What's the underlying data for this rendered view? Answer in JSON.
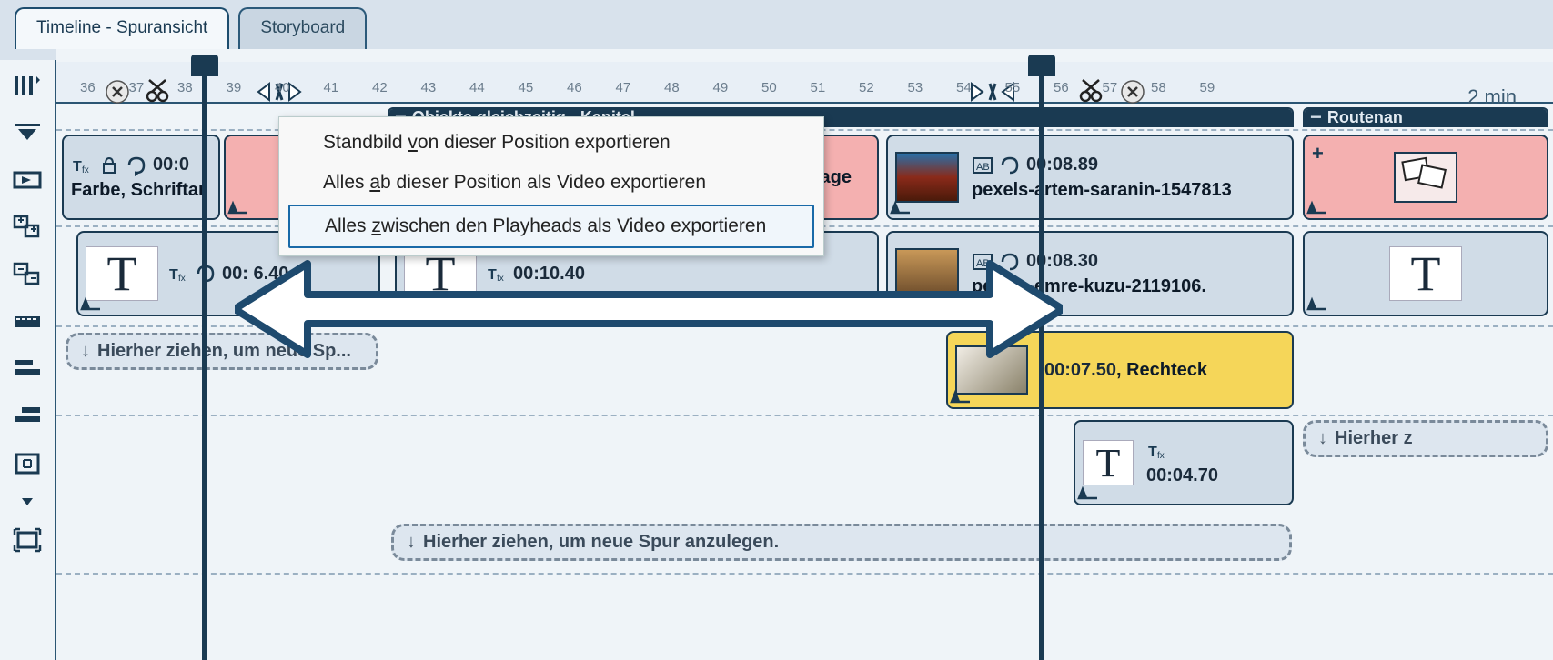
{
  "tabs": {
    "timeline": "Timeline - Spuransicht",
    "storyboard": "Storyboard"
  },
  "ruler": {
    "ticks": [
      "36",
      "37",
      "38",
      "39",
      "40",
      "41",
      "42",
      "43",
      "44",
      "45",
      "46",
      "47",
      "48",
      "49",
      "50",
      "51",
      "52",
      "53",
      "54",
      "55",
      "56",
      "57",
      "58",
      "59"
    ],
    "label": "2 min"
  },
  "chapters": {
    "objekte": "Objekte gleichzeitig - Kapitel",
    "routen": "Routenan"
  },
  "clips": {
    "farbe": {
      "time": "00:0",
      "name": "Farbe, Schriftar"
    },
    "collage": {
      "name": "Collage"
    },
    "saranin": {
      "time": "00:08.89",
      "name": "pexels-artem-saranin-1547813"
    },
    "text1": {
      "time": "00:  6.40"
    },
    "text2": {
      "time": "00:10.40"
    },
    "kuzu": {
      "time": "00:08.30",
      "name": "pexels-emre-kuzu-2119106."
    },
    "rect": {
      "time": "00:07.50",
      "name": "Rechteck"
    },
    "text3": {
      "time": "00:04.70"
    }
  },
  "drop_hints": {
    "short": "Hierher ziehen, um neue Sp...",
    "long": "Hierher ziehen, um neue Spur anzulegen.",
    "short2": "Hierher z"
  },
  "context_menu": {
    "item1_pre": "Standbild ",
    "item1_u": "v",
    "item1_post": "on dieser Position exportieren",
    "item2_pre": "Alles ",
    "item2_u": "a",
    "item2_post": "b dieser Position als Video exportieren",
    "item3_pre": "Alles ",
    "item3_u": "z",
    "item3_post": "wischen den Playheads als Video exportieren"
  }
}
